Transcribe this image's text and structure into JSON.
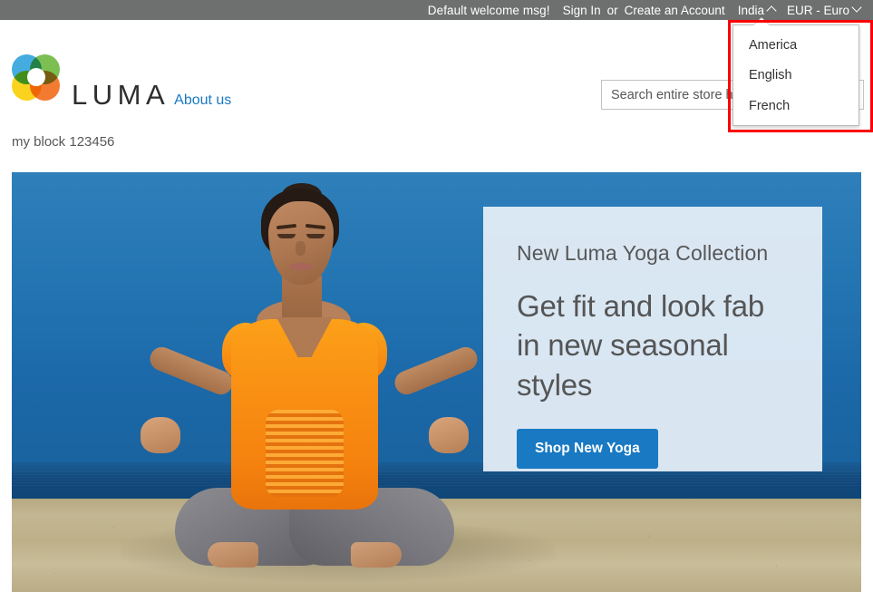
{
  "topbar": {
    "welcome_message": "Default welcome msg!",
    "sign_in_label": "Sign In",
    "or_label": "or",
    "create_account_label": "Create an Account",
    "store_switcher_label": "India",
    "store_switcher_icon": "chevron-up-icon",
    "currency_switcher_label": "EUR - Euro",
    "currency_switcher_icon": "chevron-down-icon",
    "background_color": "#6e7070"
  },
  "language_dropdown": {
    "open": true,
    "highlight_color": "#fb0007",
    "items": [
      {
        "label": "America"
      },
      {
        "label": "English"
      },
      {
        "label": "French"
      }
    ]
  },
  "header": {
    "logo_text": "LUMA",
    "logo_icon": "luma-flower-logo",
    "logo_colors": {
      "top_left": "#34a5db",
      "top_right": "#70ba43",
      "bottom_right": "#f2701f",
      "bottom_left": "#fbcf0a"
    },
    "about_link_label": "About us",
    "about_link_color": "#1979c3"
  },
  "search": {
    "value": "",
    "placeholder": "Search entire store here...",
    "icon": "search-icon"
  },
  "cms_block": {
    "text": "my block 123456"
  },
  "hero": {
    "eyebrow": "New Luma Yoga Collection",
    "title": "Get fit and look fab in new seasonal styles",
    "cta_label": "Shop New Yoga",
    "cta_color": "#1979c3",
    "panel_background": "rgba(233,241,248,0.92)",
    "image_alt": "Woman meditating in orange top on a beach"
  }
}
